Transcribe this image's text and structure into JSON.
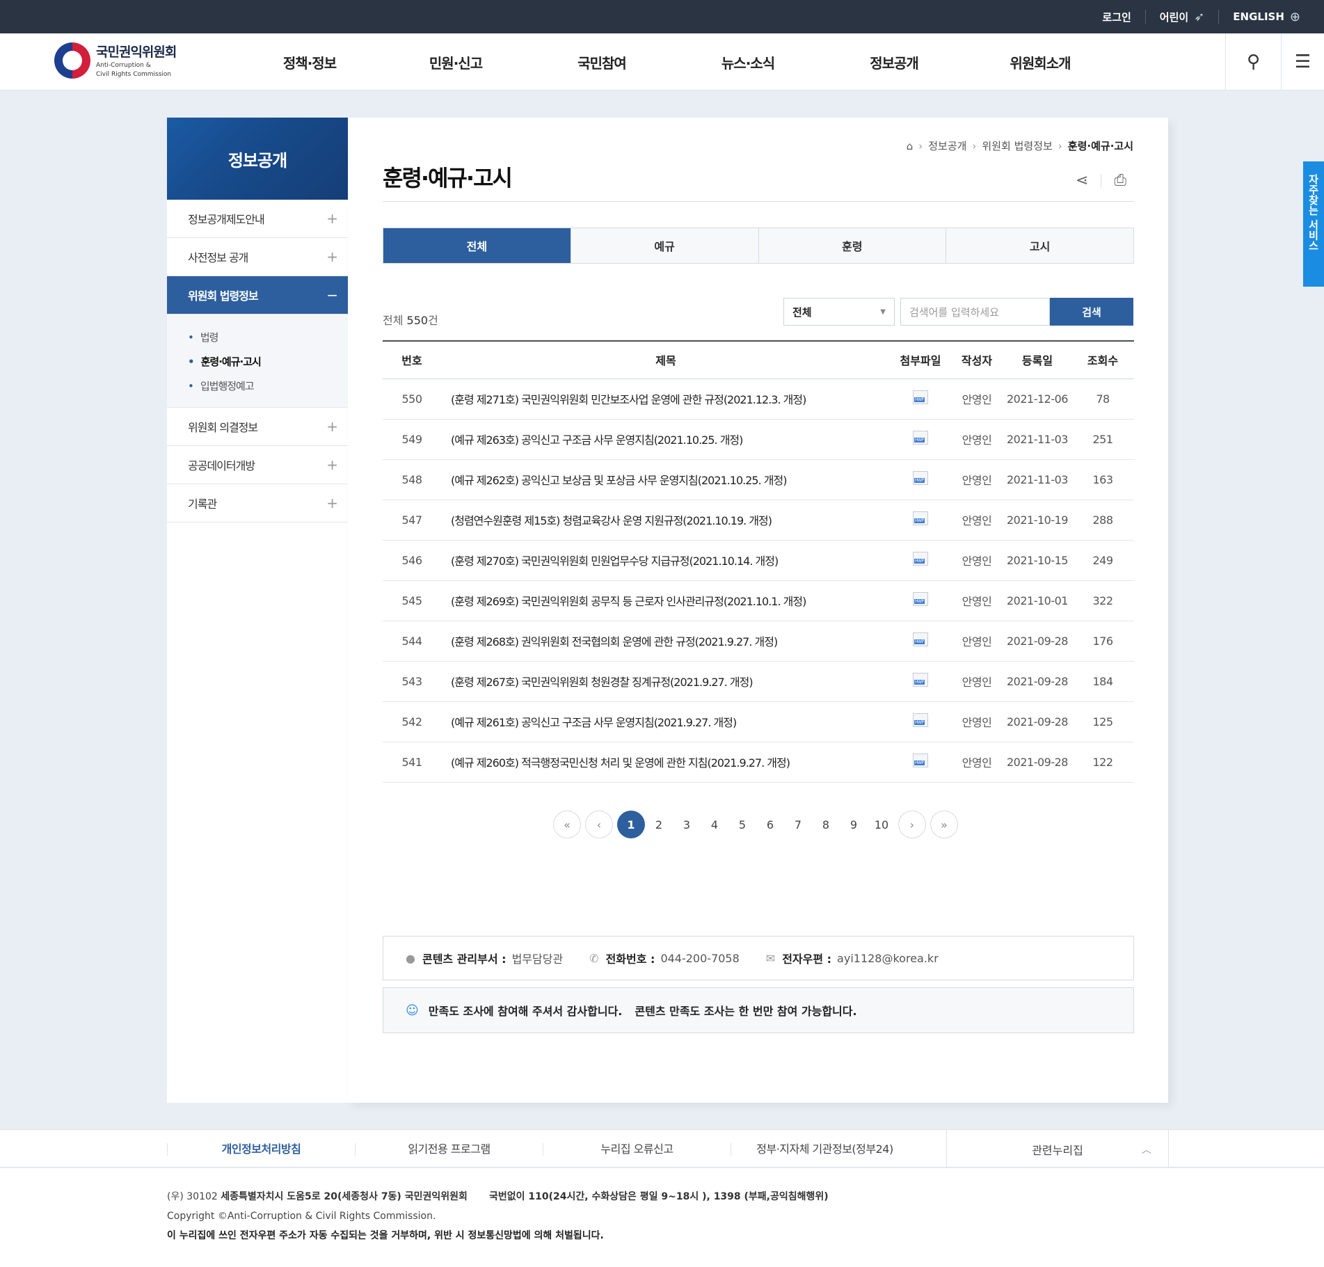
{
  "topbar": {
    "login": "로그인",
    "kids": "어린이",
    "kids_icon": "rocket-icon",
    "english": "ENGLISH",
    "english_icon": "globe-icon"
  },
  "header": {
    "logo_ko": "국민권익위원회",
    "logo_en1": "Anti-Corruption &",
    "logo_en2": "Civil Rights Commission",
    "nav": [
      "정책·정보",
      "민원·신고",
      "국민참여",
      "뉴스·소식",
      "정보공개",
      "위원회소개"
    ]
  },
  "quick": {
    "label": "자주찾는 서비스"
  },
  "lnb": {
    "title": "정보공개",
    "menus": [
      {
        "label": "정보공개제도안내",
        "mark": "+"
      },
      {
        "label": "사전정보 공개",
        "mark": "+"
      },
      {
        "label": "위원회 법령정보",
        "mark": "−"
      },
      {
        "label": "위원회 의결정보",
        "mark": "+"
      },
      {
        "label": "공공데이터개방",
        "mark": "+"
      },
      {
        "label": "기록관",
        "mark": "+"
      }
    ],
    "sub": [
      "법령",
      "훈령·예규·고시",
      "입법행정예고"
    ]
  },
  "content": {
    "breadcrumb": [
      "정보공개",
      "위원회 법령정보",
      "훈령·예규·고시"
    ],
    "title": "훈령·예규·고시",
    "tabs": [
      "전체",
      "예규",
      "훈령",
      "고시"
    ],
    "count_label": "전체",
    "count_value": "550",
    "count_unit": "건",
    "search": {
      "select": "전체",
      "placeholder": "검색어를 입력하세요",
      "button": "검색"
    },
    "table": {
      "headers": [
        "번호",
        "제목",
        "첨부파일",
        "작성자",
        "등록일",
        "조회수"
      ],
      "rows": [
        {
          "no": "550",
          "title": "(훈령 제271호) 국민권익위원회 민간보조사업 운영에 관한 규정(2021.12.3. 개정)",
          "writer": "안영인",
          "date": "2021-12-06",
          "views": "78"
        },
        {
          "no": "549",
          "title": "(예규 제263호) 공익신고 구조금 사무 운영지침(2021.10.25. 개정)",
          "writer": "안영인",
          "date": "2021-11-03",
          "views": "251"
        },
        {
          "no": "548",
          "title": "(예규 제262호) 공익신고 보상금 및 포상금 사무 운영지침(2021.10.25. 개정)",
          "writer": "안영인",
          "date": "2021-11-03",
          "views": "163"
        },
        {
          "no": "547",
          "title": "(청렴연수원훈령 제15호) 청렴교육강사 운영 지원규정(2021.10.19. 개정)",
          "writer": "안영인",
          "date": "2021-10-19",
          "views": "288"
        },
        {
          "no": "546",
          "title": "(훈령 제270호) 국민권익위원회 민원업무수당 지급규정(2021.10.14. 개정)",
          "writer": "안영인",
          "date": "2021-10-15",
          "views": "249"
        },
        {
          "no": "545",
          "title": "(훈령 제269호) 국민권익위원회 공무직 등 근로자 인사관리규정(2021.10.1. 개정)",
          "writer": "안영인",
          "date": "2021-10-01",
          "views": "322"
        },
        {
          "no": "544",
          "title": "(훈령 제268호) 권익위원회 전국협의회 운영에 관한 규정(2021.9.27. 개정)",
          "writer": "안영인",
          "date": "2021-09-28",
          "views": "176"
        },
        {
          "no": "543",
          "title": "(훈령 제267호) 국민권익위원회 청원경찰 징계규정(2021.9.27. 개정)",
          "writer": "안영인",
          "date": "2021-09-28",
          "views": "184"
        },
        {
          "no": "542",
          "title": "(예규 제261호) 공익신고 구조금 사무 운영지침(2021.9.27. 개정)",
          "writer": "안영인",
          "date": "2021-09-28",
          "views": "125"
        },
        {
          "no": "541",
          "title": "(예규 제260호) 적극행정국민신청 처리 및 운영에 관한 지침(2021.9.27. 개정)",
          "writer": "안영인",
          "date": "2021-09-28",
          "views": "122"
        }
      ]
    },
    "paging": {
      "current": "1",
      "pages": [
        "1",
        "2",
        "3",
        "4",
        "5",
        "6",
        "7",
        "8",
        "9",
        "10"
      ]
    },
    "info": {
      "dept_label": "콘텐츠 관리부서 :",
      "dept": "법무담당관",
      "tel_label": "전화번호 :",
      "tel": "044-200-7058",
      "email_label": "전자우편 :",
      "email": "ayi1128@korea.kr"
    },
    "survey": {
      "msg1": "만족도 조사에 참여해 주셔서 감사합니다.",
      "msg2": "콘텐츠 만족도 조사는 한 번만 참여 가능합니다."
    }
  },
  "footer": {
    "links": [
      "개인정보처리방침",
      "읽기전용 프로그램",
      "누리집 오류신고",
      "정부·지자체 기관정보(정부24)"
    ],
    "related": "관련누리집",
    "addr_prefix": "(우) 30102",
    "addr": "세종특별자치시 도움5로 20(세종청사 7동) 국민권익위원회",
    "phone": "국번없이 110(24시간, 수화상담은 평일 9~18시 ), 1398 (부패,공익침해행위)",
    "copyright": "Copyright ©Anti-Corruption & Civil Rights Commission.",
    "warning": "이 누리집에 쓰인 전자우편 주소가 자동 수집되는 것을 거부하며, 위반 시 정보통신망법에 의해 처벌됩니다."
  },
  "colors": {
    "primary": "#2d5f9e",
    "topbar": "#2a3443",
    "quick": "#1a8de2"
  }
}
